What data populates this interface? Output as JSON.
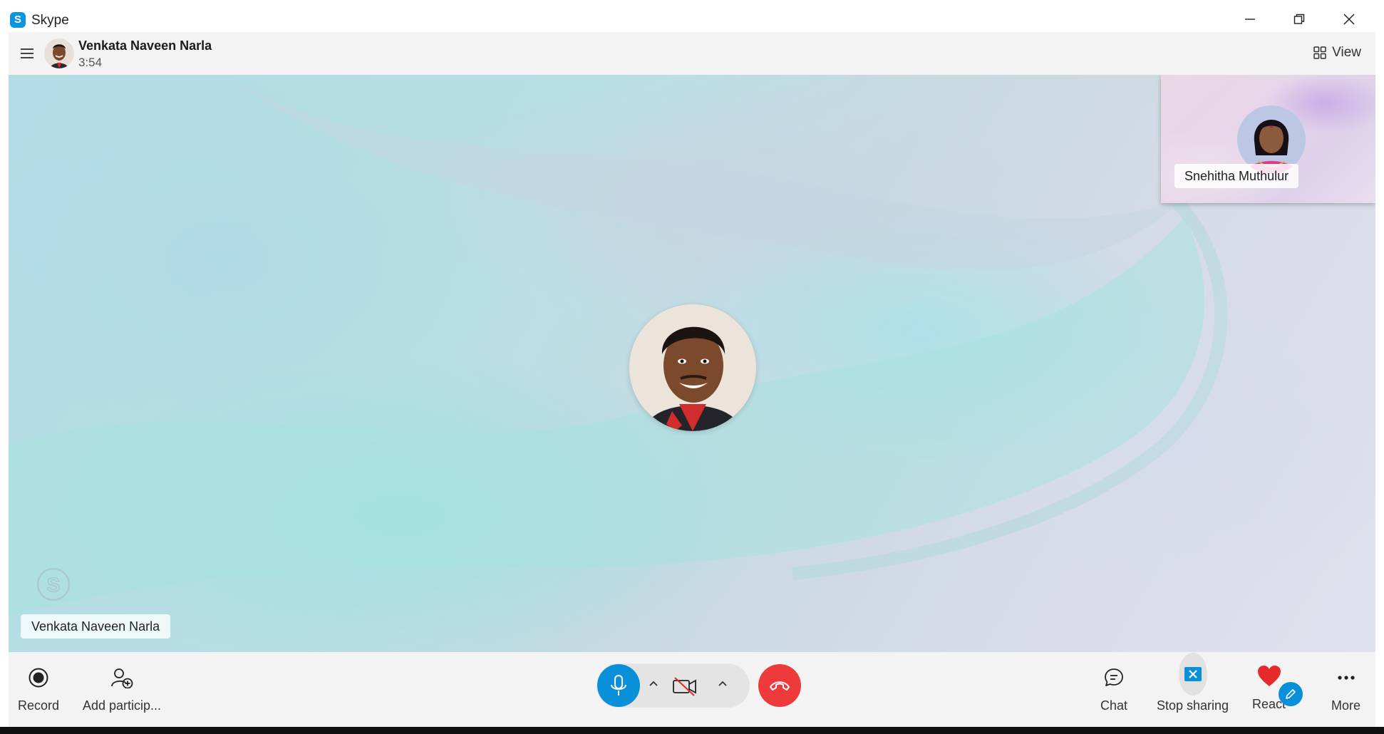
{
  "window": {
    "app_name": "Skype",
    "controls": [
      "minimize",
      "restore",
      "close"
    ]
  },
  "header": {
    "contact_name": "Venkata Naveen Narla",
    "call_duration": "3:54",
    "view_label": "View",
    "icons": {
      "menu": "hamburger-menu-icon",
      "view": "grid-view-icon"
    }
  },
  "stage": {
    "main_participant": "Venkata Naveen Narla",
    "thumbnail_participant": "Snehitha Muthulur"
  },
  "toolbar": {
    "record_label": "Record",
    "add_participants_label": "Add particip...",
    "chat_label": "Chat",
    "stop_sharing_label": "Stop sharing",
    "react_label": "React",
    "more_label": "More",
    "mic_state": "on",
    "camera_state": "off"
  },
  "colors": {
    "accent": "#0a8fd9",
    "end_call": "#ee3a3a",
    "react_heart": "#e52b2b",
    "toolbar_bg": "#f3f3f3"
  }
}
